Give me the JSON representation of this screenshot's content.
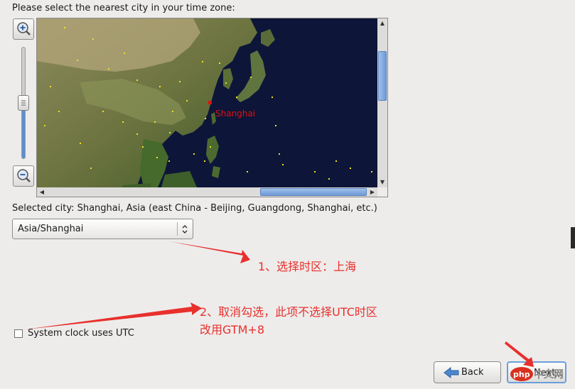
{
  "prompt": "Please select the nearest city in your time zone:",
  "map": {
    "city_label": "Shanghai"
  },
  "selected_city": "Selected city: Shanghai, Asia (east China - Beijing, Guangdong, Shanghai, etc.)",
  "timezone_select": {
    "value": "Asia/Shanghai"
  },
  "utc_checkbox": {
    "label": "System clock uses UTC",
    "checked": false
  },
  "buttons": {
    "back": "Back",
    "next": "Next"
  },
  "annotations": {
    "note1": "1、选择时区：上海",
    "note2_line1": "2、取消勾选，此项不选择UTC时区",
    "note2_line2": "改用GTM+8"
  },
  "watermark": {
    "latin": "php",
    "cjk": "中文网"
  },
  "colors": {
    "annotation": "#e8302c",
    "ocean": "#0d1638",
    "accent": "#6b9edc",
    "city_marker": "#e01010"
  },
  "icons": [
    "zoom-in-icon",
    "zoom-out-icon",
    "back-arrow-icon",
    "chevron-updown-icon"
  ]
}
